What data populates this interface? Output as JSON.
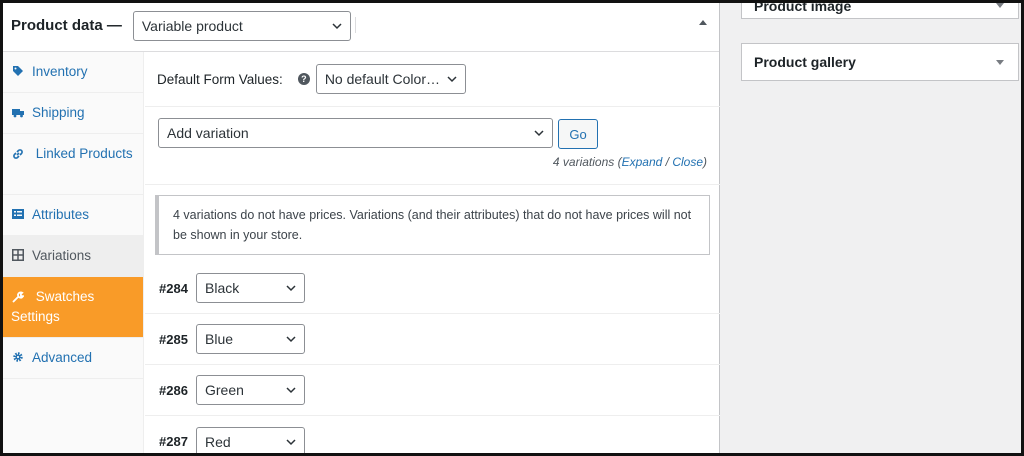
{
  "product_data": {
    "title": "Product data —",
    "type_select": "Variable product"
  },
  "tabs": [
    {
      "label": "Inventory",
      "icon": "tag-icon"
    },
    {
      "label": "Shipping",
      "icon": "truck-icon"
    },
    {
      "label": "Linked Products",
      "icon": "link-icon"
    },
    {
      "label": "Attributes",
      "icon": "list-icon"
    },
    {
      "label": "Variations",
      "icon": "grid-icon"
    },
    {
      "label": "Swatches Settings",
      "icon": "wrench-icon"
    },
    {
      "label": "Advanced",
      "icon": "gear-icon"
    }
  ],
  "defaults": {
    "label": "Default Form Values:",
    "help": "?",
    "select": "No default Color…"
  },
  "add_variation": {
    "select": "Add variation",
    "go": "Go",
    "count_prefix": "4 variations (",
    "expand": "Expand",
    "sep": " / ",
    "close": "Close",
    "count_suffix": ")"
  },
  "notice": "4 variations do not have prices. Variations (and their attributes) that do not have prices will not be shown in your store.",
  "variations": [
    {
      "id": "#284",
      "value": "Black"
    },
    {
      "id": "#285",
      "value": "Blue"
    },
    {
      "id": "#286",
      "value": "Green"
    },
    {
      "id": "#287",
      "value": "Red"
    }
  ],
  "sidebar": {
    "product_image": "Product image",
    "product_gallery": "Product gallery"
  },
  "colors": {
    "accent": "#2271b1",
    "swatch_tab": "#f99b28"
  }
}
